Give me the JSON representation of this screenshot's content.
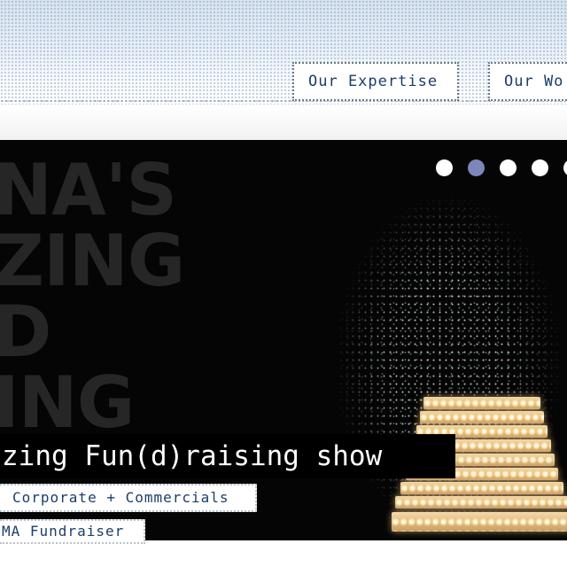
{
  "nav": {
    "items": [
      {
        "label": "Our Expertise"
      },
      {
        "label": "Our Wo"
      }
    ]
  },
  "hero": {
    "marquee_lines": [
      "NA'S",
      "ZING",
      "D",
      "ING"
    ],
    "carousel": {
      "dot_count": 5,
      "active_index": 1
    },
    "headline": "zing Fun(d)raising show",
    "tags": [
      "Corporate + Commercials",
      "MA Fundraiser"
    ]
  },
  "colors": {
    "nav_text": "#1c3d6a",
    "hero_bg": "#050505",
    "dot_active": "#7c86b8",
    "dot_inactive": "#ffffff"
  }
}
